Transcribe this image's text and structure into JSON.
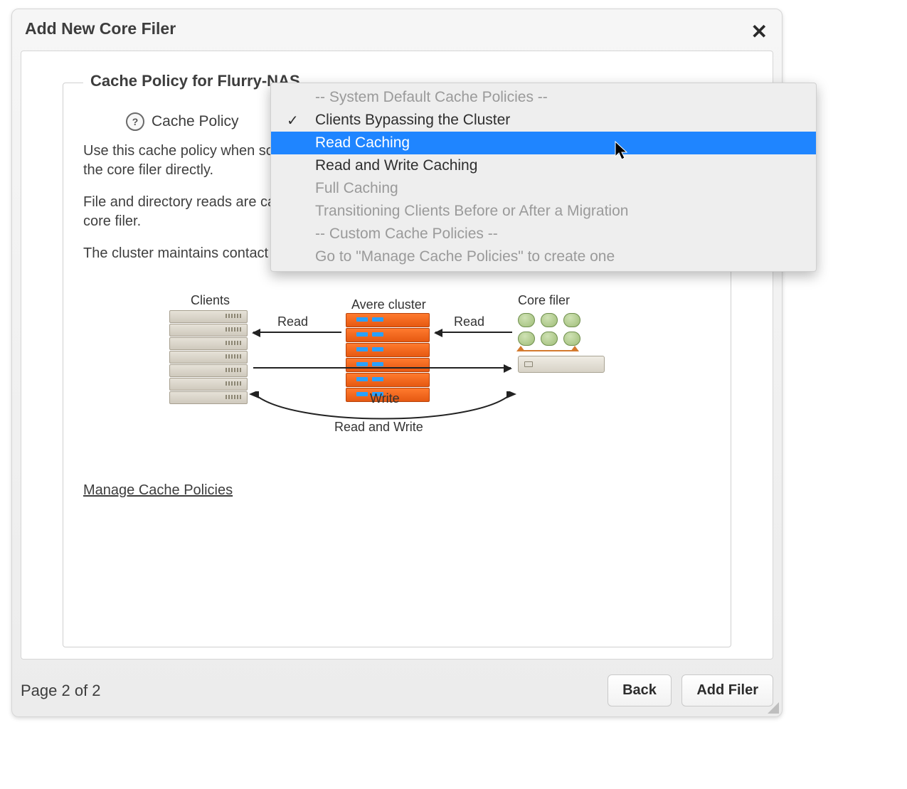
{
  "dialog": {
    "title": "Add New Core Filer",
    "legend": "Cache Policy for Flurry-NAS"
  },
  "policy": {
    "label": "Cache Policy",
    "desc1": "Use this cache policy when some clients are mounting the Avere cluster and others are mounting the core filer directly.",
    "desc2": "File and directory reads are cached. Writes are not cached by the cluster; they pass directly to the core filer.",
    "desc3": "The cluster maintains contact with the core filer to maintain file system consistency.",
    "manage_link": "Manage Cache Policies"
  },
  "dropdown": {
    "items": [
      {
        "label": "-- System Default Cache Policies --",
        "type": "header"
      },
      {
        "label": "Clients Bypassing the Cluster",
        "type": "option",
        "checked": true
      },
      {
        "label": "Read Caching",
        "type": "option",
        "highlight": true
      },
      {
        "label": "Read and Write Caching",
        "type": "option"
      },
      {
        "label": "Full Caching",
        "type": "disabled"
      },
      {
        "label": "Transitioning Clients Before or After a Migration",
        "type": "disabled"
      },
      {
        "label": "-- Custom Cache Policies --",
        "type": "header"
      },
      {
        "label": "Go to \"Manage Cache Policies\" to create one",
        "type": "disabled"
      }
    ]
  },
  "diagram": {
    "clients": "Clients",
    "cluster": "Avere cluster",
    "core": "Core filer",
    "read": "Read",
    "write": "Write",
    "rw": "Read and Write"
  },
  "footer": {
    "page": "Page 2 of 2",
    "back": "Back",
    "add": "Add Filer"
  }
}
